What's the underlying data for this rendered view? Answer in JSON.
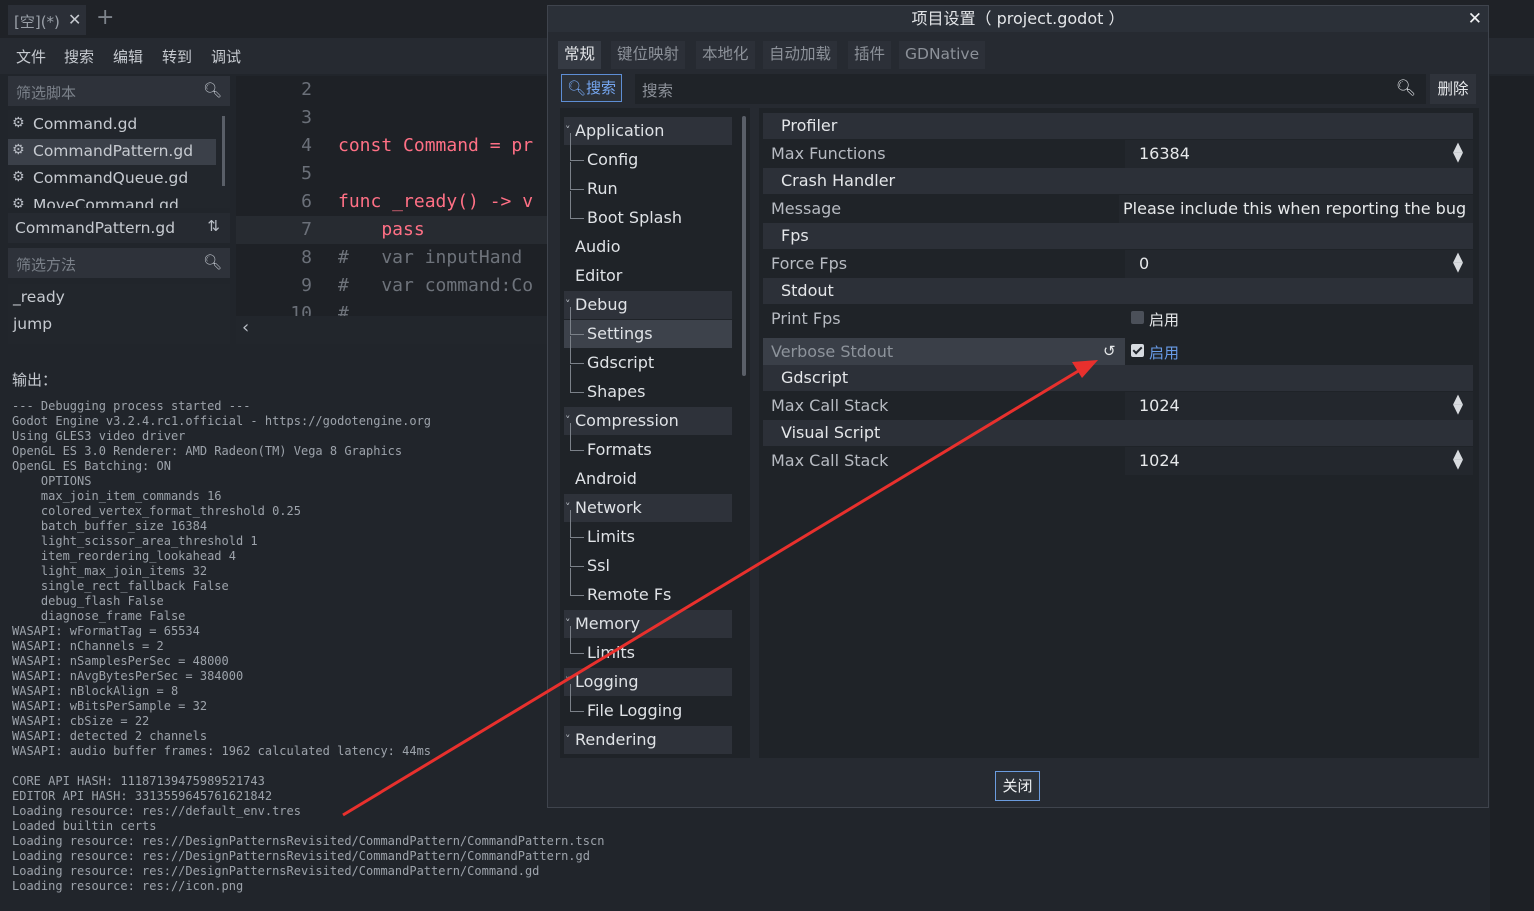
{
  "editor": {
    "file_tab": {
      "title": "[空](*)",
      "close": "✕",
      "add": "+"
    },
    "menu": [
      "文件",
      "搜索",
      "编辑",
      "转到",
      "调试"
    ],
    "script_filter_placeholder": "筛选脚本",
    "scripts": [
      "Command.gd",
      "CommandPattern.gd",
      "CommandQueue.gd",
      "MoveCommand.gd"
    ],
    "selected_script": "CommandPattern.gd",
    "current_script": "CommandPattern.gd",
    "method_filter_placeholder": "筛选方法",
    "methods": [
      "_ready",
      "jump"
    ],
    "code": {
      "lines": [
        {
          "n": "2",
          "text": ""
        },
        {
          "n": "3",
          "text": ""
        },
        {
          "n": "4",
          "text": "const Command = pr"
        },
        {
          "n": "5",
          "text": ""
        },
        {
          "n": "6",
          "text": "func _ready() -> v"
        },
        {
          "n": "7",
          "text": "    pass"
        },
        {
          "n": "8",
          "text": "#   var inputHand"
        },
        {
          "n": "9",
          "text": "#   var command:Co"
        },
        {
          "n": "10",
          "text": "#"
        }
      ]
    },
    "code_scroll_left": "‹",
    "output_title": "输出：",
    "output_log": [
      "--- Debugging process started ---",
      "Godot Engine v3.2.4.rc1.official - https://godotengine.org",
      "Using GLES3 video driver",
      "OpenGL ES 3.0 Renderer: AMD Radeon(TM) Vega 8 Graphics",
      "OpenGL ES Batching: ON",
      "    OPTIONS",
      "    max_join_item_commands 16",
      "    colored_vertex_format_threshold 0.25",
      "    batch_buffer_size 16384",
      "    light_scissor_area_threshold 1",
      "    item_reordering_lookahead 4",
      "    light_max_join_items 32",
      "    single_rect_fallback False",
      "    debug_flash False",
      "    diagnose_frame False",
      "WASAPI: wFormatTag = 65534",
      "WASAPI: nChannels = 2",
      "WASAPI: nSamplesPerSec = 48000",
      "WASAPI: nAvgBytesPerSec = 384000",
      "WASAPI: nBlockAlign = 8",
      "WASAPI: wBitsPerSample = 32",
      "WASAPI: cbSize = 22",
      "WASAPI: detected 2 channels",
      "WASAPI: audio buffer frames: 1962 calculated latency: 44ms",
      "",
      "CORE API HASH: 11187139475989521743",
      "EDITOR API HASH: 3313559645761621842",
      "Loading resource: res://default_env.tres",
      "Loaded builtin certs",
      "Loading resource: res://DesignPatternsRevisited/CommandPattern/CommandPattern.tscn",
      "Loading resource: res://DesignPatternsRevisited/CommandPattern/CommandPattern.gd",
      "Loading resource: res://DesignPatternsRevisited/CommandPattern/Command.gd",
      "Loading resource: res://icon.png"
    ]
  },
  "dialog": {
    "title": "项目设置（ project.godot ）",
    "close_icon": "✕",
    "tabs": [
      "常规",
      "键位映射",
      "本地化",
      "自动加载",
      "插件",
      "GDNative"
    ],
    "active_tab": "常规",
    "search_button": "搜索",
    "search_placeholder": "搜索",
    "delete_button": "删除",
    "tree": [
      {
        "label": "Application",
        "level": 0,
        "expanded": true
      },
      {
        "label": "Config",
        "level": 1
      },
      {
        "label": "Run",
        "level": 1
      },
      {
        "label": "Boot Splash",
        "level": 1
      },
      {
        "label": "Audio",
        "level": 0
      },
      {
        "label": "Editor",
        "level": 0
      },
      {
        "label": "Debug",
        "level": 0,
        "expanded": true
      },
      {
        "label": "Settings",
        "level": 1,
        "selected": true
      },
      {
        "label": "Gdscript",
        "level": 1
      },
      {
        "label": "Shapes",
        "level": 1
      },
      {
        "label": "Compression",
        "level": 0,
        "expanded": true
      },
      {
        "label": "Formats",
        "level": 1
      },
      {
        "label": "Android",
        "level": 0
      },
      {
        "label": "Network",
        "level": 0,
        "expanded": true
      },
      {
        "label": "Limits",
        "level": 1
      },
      {
        "label": "Ssl",
        "level": 1
      },
      {
        "label": "Remote Fs",
        "level": 1
      },
      {
        "label": "Memory",
        "level": 0,
        "expanded": true
      },
      {
        "label": "Limits",
        "level": 1
      },
      {
        "label": "Logging",
        "level": 0,
        "expanded": true
      },
      {
        "label": "File Logging",
        "level": 1
      },
      {
        "label": "Rendering",
        "level": 0,
        "expanded": true
      }
    ],
    "properties": {
      "profiler_header": "Profiler",
      "max_functions_label": "Max Functions",
      "max_functions_value": "16384",
      "crash_handler_header": "Crash Handler",
      "message_label": "Message",
      "message_value": "Please include this when reporting the bug",
      "fps_header": "Fps",
      "force_fps_label": "Force Fps",
      "force_fps_value": "0",
      "stdout_header": "Stdout",
      "print_fps_label": "Print Fps",
      "print_fps_checkbox": "启用",
      "print_fps_checked": false,
      "verbose_stdout_label": "Verbose Stdout",
      "verbose_stdout_checkbox": "启用",
      "verbose_stdout_checked": true,
      "gdscript_header": "Gdscript",
      "gdscript_max_call_stack_label": "Max Call Stack",
      "gdscript_max_call_stack_value": "1024",
      "visual_script_header": "Visual Script",
      "visual_script_max_call_stack_label": "Max Call Stack",
      "visual_script_max_call_stack_value": "1024"
    },
    "close_button": "关闭"
  },
  "colors": {
    "accent": "#699ce8",
    "annotation_arrow": "#e8302d",
    "keyword": "#ff7085",
    "identifier": "#bce0ff"
  }
}
